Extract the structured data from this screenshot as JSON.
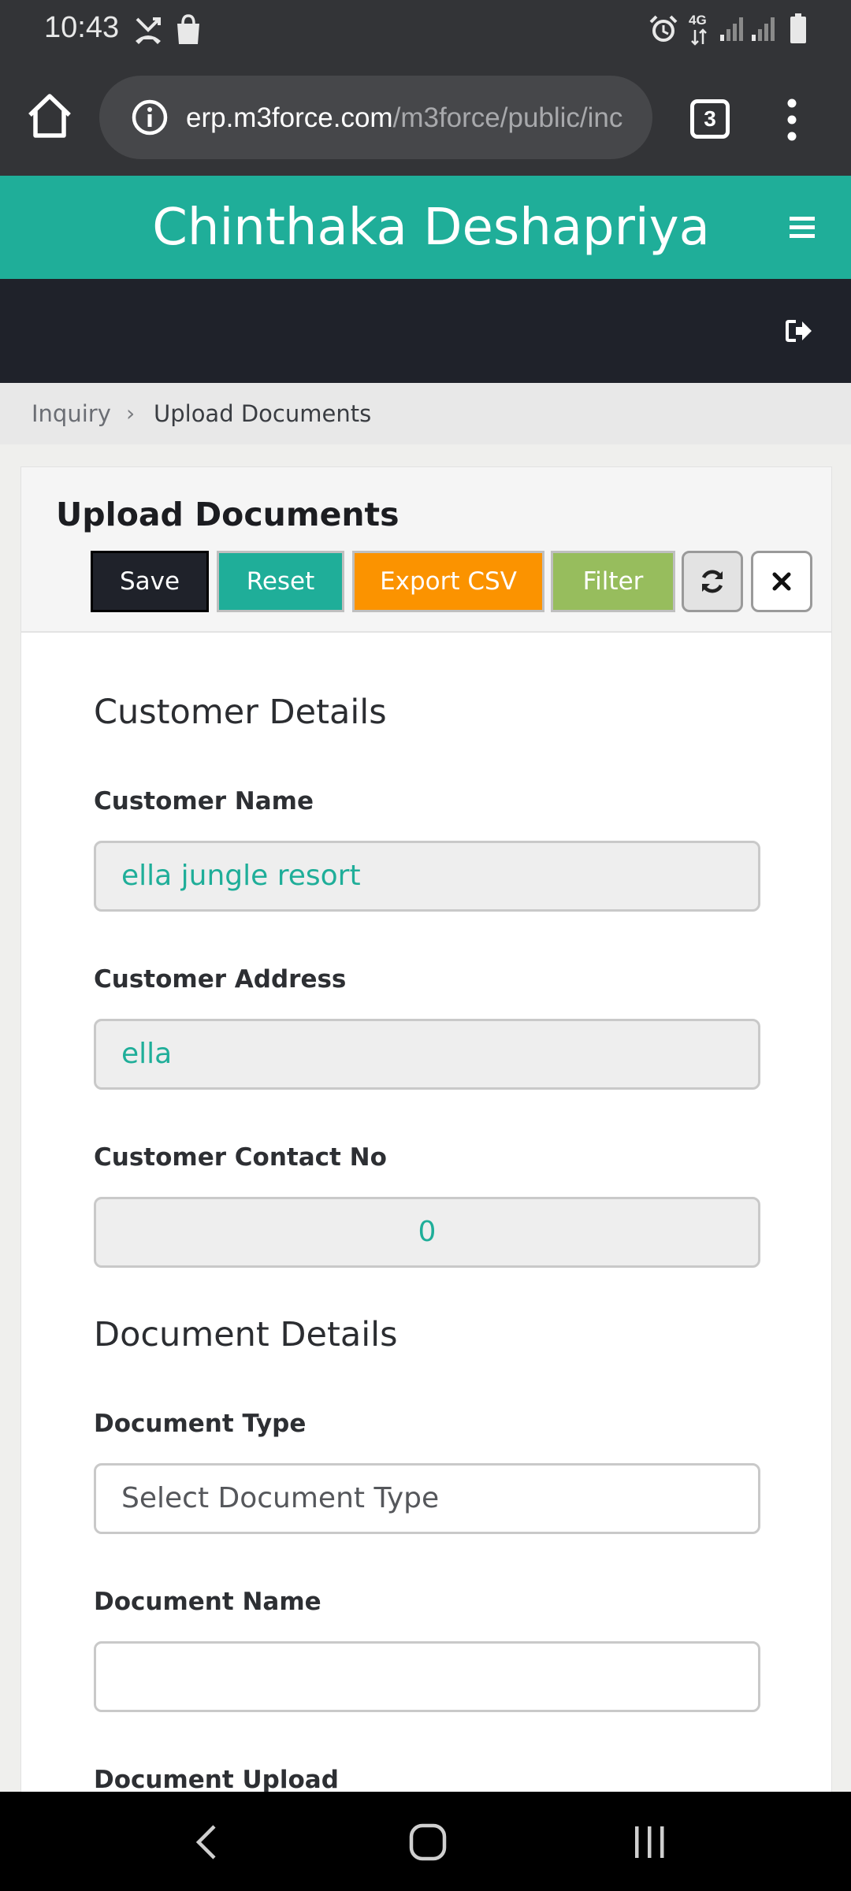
{
  "status_bar": {
    "time": "10:43",
    "network": "4G",
    "icons": [
      "missed-call-icon",
      "shopping-bag-icon",
      "alarm-icon",
      "signal-icon",
      "signal-icon",
      "battery-icon"
    ]
  },
  "browser": {
    "url_domain": "erp.m3force.com",
    "url_path": "/m3force/public/inc",
    "tab_count": "3",
    "icons": [
      "home-icon",
      "info-icon",
      "more-vert-icon"
    ]
  },
  "app": {
    "title": "Chinthaka Deshapriya",
    "menu_icon": "hamburger-icon",
    "logout_icon": "sign-out-icon",
    "brand_color": "#1fae99"
  },
  "breadcrumb": {
    "items": [
      "Inquiry",
      "Upload Documents"
    ],
    "separator": "›"
  },
  "card": {
    "title": "Upload Documents",
    "toolbar": {
      "save_label": "Save",
      "reset_label": "Reset",
      "export_label": "Export CSV",
      "filter_label": "Filter",
      "refresh_icon": "refresh-icon",
      "close_icon": "close-icon"
    },
    "customer_section": {
      "title": "Customer Details",
      "name_label": "Customer Name",
      "name_value": "ella jungle resort",
      "address_label": "Customer Address",
      "address_value": "ella",
      "contact_label": "Customer Contact No",
      "contact_value": "0"
    },
    "document_section": {
      "title": "Document Details",
      "type_label": "Document Type",
      "type_placeholder": "Select Document Type",
      "name_label": "Document Name",
      "name_value": "",
      "upload_label": "Document Upload"
    }
  },
  "nav_bar": {
    "icons": [
      "back-icon",
      "home-circle-icon",
      "recents-icon"
    ]
  }
}
